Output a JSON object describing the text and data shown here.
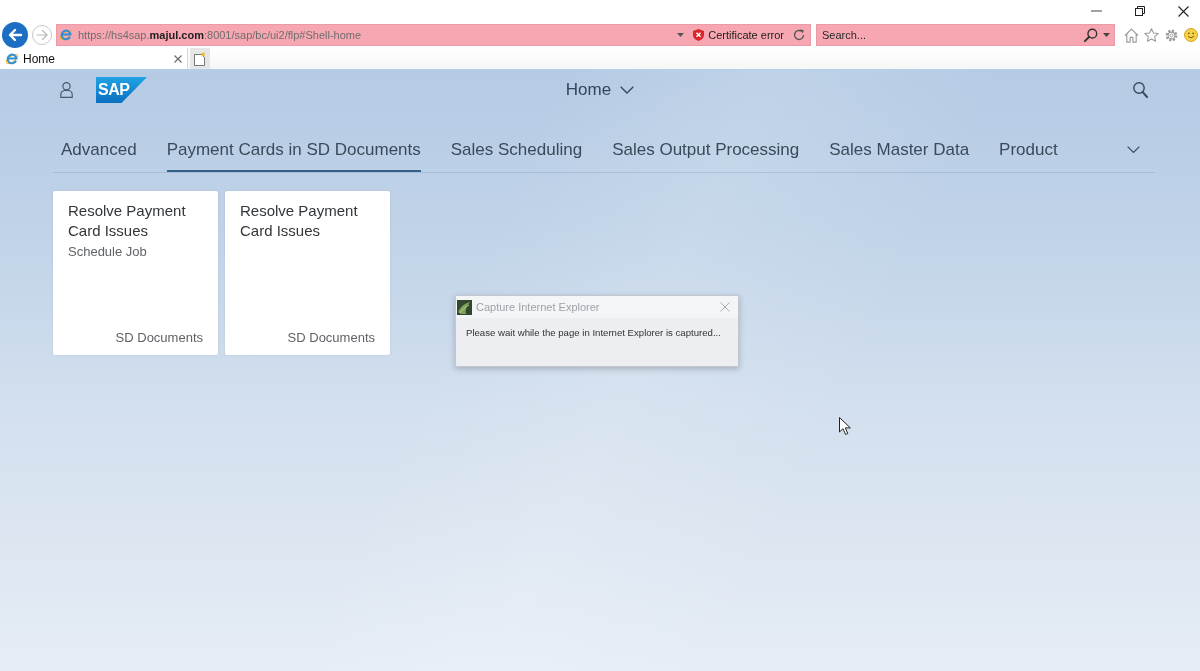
{
  "browser": {
    "nav_buttons": [
      {
        "kind": "back",
        "disabled": false
      },
      {
        "kind": "forward",
        "disabled": true
      }
    ],
    "address_bar": {
      "url": "https://hs4sap.**majul.com**:8001/sap/bc/ui2/flp#Shell-home",
      "certificate_error": "Certificate error"
    },
    "search_box": {
      "placeholder": "Search..."
    },
    "tabs": [
      {
        "label": "Home",
        "selected": true
      }
    ]
  },
  "shell": {
    "logo": "SAP",
    "title": "Home"
  },
  "app_tabs": [
    {
      "label": "Advanced",
      "selected": false
    },
    {
      "label": "Payment Cards in SD Documents",
      "selected": true
    },
    {
      "label": "Sales Scheduling",
      "selected": false
    },
    {
      "label": "Sales Output Processing",
      "selected": false
    },
    {
      "label": "Sales Master Data",
      "selected": false
    },
    {
      "label": "Product",
      "selected": false
    }
  ],
  "tiles": [
    {
      "title": "Resolve Payment Card Issues",
      "subtitle": "Schedule Job",
      "footer": "SD Documents"
    },
    {
      "title": "Resolve Payment Card Issues",
      "footer": "SD Documents"
    }
  ],
  "dialog": {
    "title": "Capture Internet Explorer",
    "message": "Please wait while the page in Internet Explorer is captured..."
  }
}
